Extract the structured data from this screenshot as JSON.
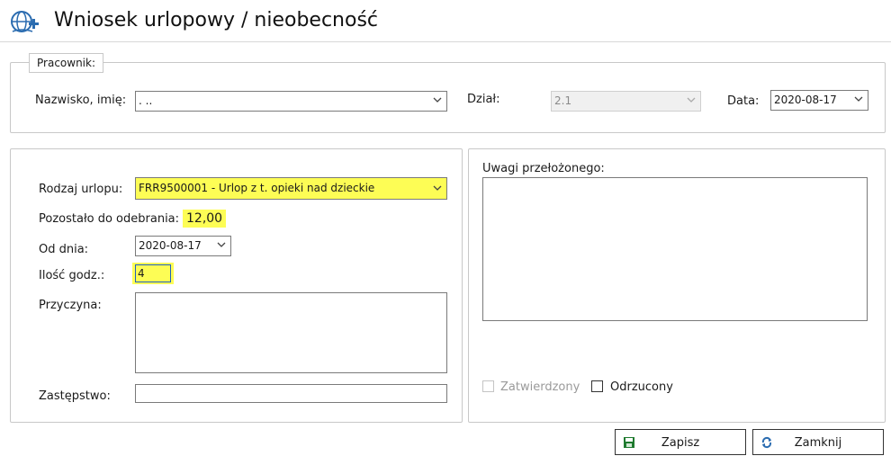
{
  "window": {
    "title": "Wniosek urlopowy / nieobecność",
    "icon": "globe-plus-icon"
  },
  "pracownik": {
    "legend": "Pracownik:",
    "nazwisko_label": "Nazwisko, imię:",
    "nazwisko_value": ".                    ..",
    "dzial_label": "Dział:",
    "dzial_value": "2.1",
    "data_label": "Data:",
    "data_value": "2020-08-17"
  },
  "urlop": {
    "rodzaj_label": "Rodzaj urlopu:",
    "rodzaj_value": "FRR9500001 - Urlop z t. opieki nad dzieckie",
    "pozostalo_label": "Pozostało do odebrania:",
    "pozostalo_value": "12,00",
    "od_dnia_label": "Od dnia:",
    "od_dnia_value": "2020-08-17",
    "ilosc_label": "Ilość godz.:",
    "ilosc_value": "4",
    "przyczyna_label": "Przyczyna:",
    "przyczyna_value": "",
    "zastepstwo_label": "Zastępstwo:",
    "zastepstwo_value": ""
  },
  "uwagi": {
    "label": "Uwagi przełożonego:",
    "value": "",
    "zatwierdzony_label": "Zatwierdzony",
    "odrzucony_label": "Odrzucony"
  },
  "buttons": {
    "save_label": "Zapisz",
    "close_label": "Zamknij"
  },
  "colors": {
    "highlight": "#fdfd55",
    "save_icon": "#1e7a2e",
    "close_icon": "#2b6cb0"
  }
}
